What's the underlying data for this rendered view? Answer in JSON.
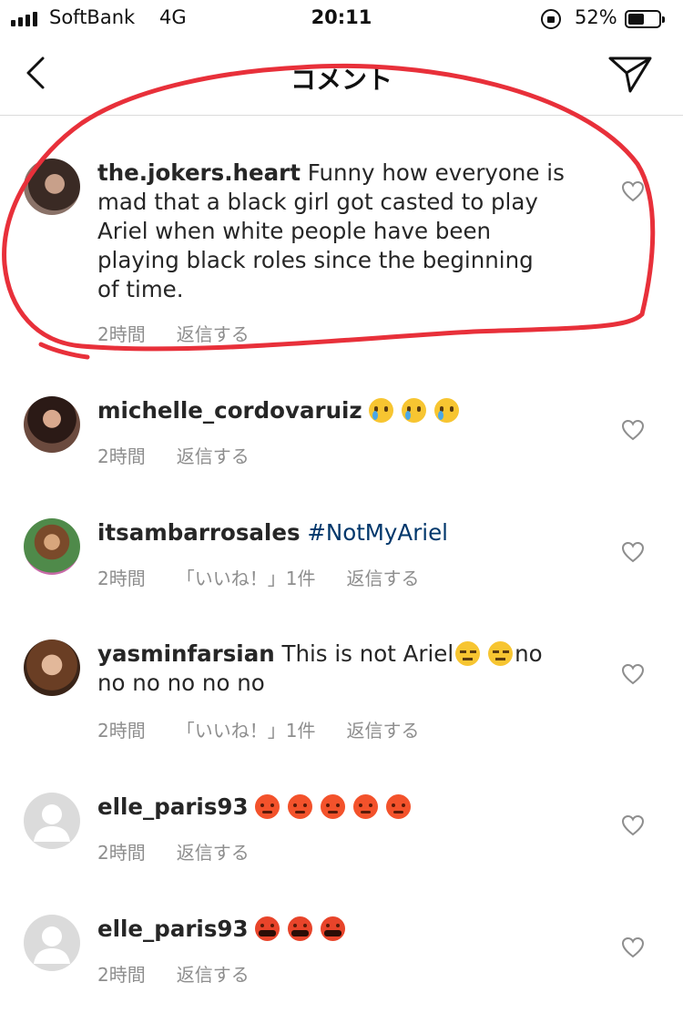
{
  "status_bar": {
    "carrier": "SoftBank",
    "network": "4G",
    "time": "20:11",
    "battery_percent": "52%",
    "battery_level": 0.52
  },
  "nav": {
    "title": "コメント",
    "back_icon": "chevron-left-icon",
    "send_icon": "paper-plane-icon"
  },
  "colors": {
    "text": "#262626",
    "meta": "#8e8e8e",
    "hashtag": "#00376b",
    "annotation_red": "#e8303a"
  },
  "comments": [
    {
      "username": "the.jokers.heart",
      "text_lines": [
        "Funny how everyone is",
        "mad that a black girl got casted to play",
        "Ariel when white people have been",
        "playing black roles since the beginning",
        "of time."
      ],
      "time": "2時間",
      "likes": "",
      "reply": "返信する"
    },
    {
      "username": "michelle_cordovaruiz",
      "text": "",
      "emojis": [
        "crying-face-emoji",
        "crying-face-emoji",
        "crying-face-emoji"
      ],
      "time": "2時間",
      "likes": "",
      "reply": "返信する"
    },
    {
      "username": "itsambarrosales",
      "hashtag": "#NotMyAriel",
      "time": "2時間",
      "likes": "「いいね！」1件",
      "reply": "返信する"
    },
    {
      "username": "yasminfarsian",
      "text_before_emoji": "This is not Ariel",
      "emojis": [
        "expressionless-face-emoji",
        "expressionless-face-emoji"
      ],
      "text_after_emoji": "no",
      "text_line2": "no no no no no",
      "time": "2時間",
      "likes": "「いいね！」1件",
      "reply": "返信する"
    },
    {
      "username": "elle_paris93",
      "emojis": [
        "pouting-face-emoji",
        "pouting-face-emoji",
        "pouting-face-emoji",
        "pouting-face-emoji",
        "pouting-face-emoji"
      ],
      "time": "2時間",
      "likes": "",
      "reply": "返信する"
    },
    {
      "username": "elle_paris93",
      "emojis": [
        "cursing-face-emoji",
        "cursing-face-emoji",
        "cursing-face-emoji"
      ],
      "time": "2時間",
      "likes": "",
      "reply": "返信する"
    }
  ]
}
